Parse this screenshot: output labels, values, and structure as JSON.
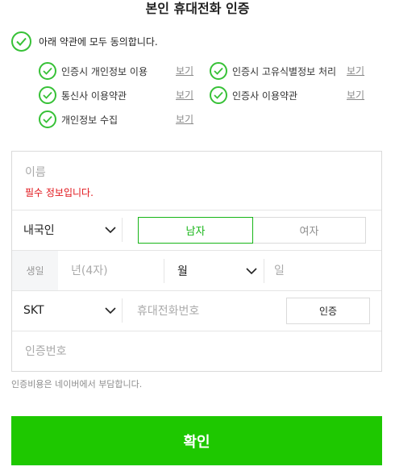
{
  "header": {
    "title": "본인 휴대전화 인증"
  },
  "agree_all": {
    "label": "아래 약관에 모두 동의합니다.",
    "checked": true
  },
  "terms": [
    {
      "label": "인증시 개인정보 이용",
      "view": "보기",
      "checked": true
    },
    {
      "label": "인증시 고유식별정보 처리",
      "view": "보기",
      "checked": true
    },
    {
      "label": "통신사 이용약관",
      "view": "보기",
      "checked": true
    },
    {
      "label": "인증사 이용약관",
      "view": "보기",
      "checked": true
    },
    {
      "label": "개인정보 수집",
      "view": "보기",
      "checked": true
    }
  ],
  "form": {
    "name_placeholder": "이름",
    "name_error": "필수 정보입니다.",
    "nationality": "내국인",
    "gender_male": "남자",
    "gender_female": "여자",
    "gender_selected": "남자",
    "birth_label": "생일",
    "year_placeholder": "년(4자)",
    "month": "월",
    "day_placeholder": "일",
    "carrier": "SKT",
    "phone_placeholder": "휴대전화번호",
    "auth_button": "인증",
    "code_placeholder": "인증번호"
  },
  "note": "인증비용은 네이버에서 부담합니다.",
  "confirm_button": "확인",
  "colors": {
    "accent": "#1ec800",
    "check": "#37c137",
    "error": "#e1141a"
  }
}
